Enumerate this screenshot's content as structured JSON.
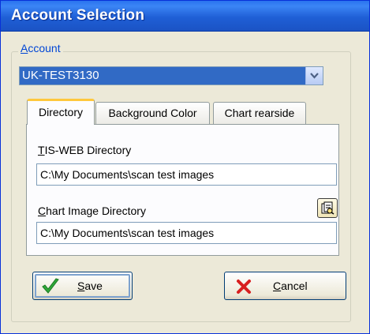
{
  "window": {
    "title": "Account Selection"
  },
  "account": {
    "group_label_prefix": "",
    "group_label_underline": "A",
    "group_label_rest": "ccount",
    "selected_value": "UK-TEST3130"
  },
  "tabs": [
    {
      "label": "Directory",
      "active": true
    },
    {
      "label": "Background Color",
      "active": false
    },
    {
      "label": "Chart rearside",
      "active": false
    }
  ],
  "directory": {
    "tisweb_label_underline": "T",
    "tisweb_label_rest": "IS-WEB Directory",
    "tisweb_value": "C:\\My Documents\\scan test images",
    "chart_label_underline": "C",
    "chart_label_rest": "hart Image Directory",
    "chart_value": "C:\\My Documents\\scan test images"
  },
  "buttons": {
    "save_underline": "S",
    "save_rest": "ave",
    "cancel_underline": "C",
    "cancel_rest": "ancel"
  },
  "colors": {
    "titlebar": "#1f5fd6",
    "selection": "#316ac5",
    "tab_highlight": "#ffc83c",
    "dialog_bg": "#ece9d8"
  }
}
